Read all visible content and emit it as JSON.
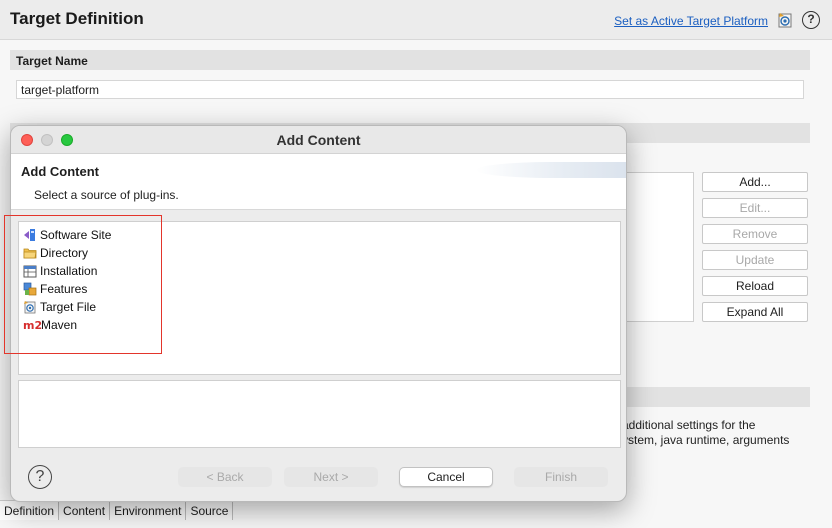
{
  "editor": {
    "title": "Target Definition",
    "active_link": "Set as Active Target Platform",
    "target_name_label": "Target Name",
    "target_name_value": "target-platform",
    "buttons": {
      "add": "Add...",
      "edit": "Edit...",
      "remove": "Remove",
      "update": "Update",
      "reload": "Reload",
      "expand_all": "Expand All"
    },
    "environment_text_line1": "additional settings for the",
    "environment_text_line2": "ystem, java runtime, arguments",
    "tabs": [
      "Definition",
      "Content",
      "Environment",
      "Source"
    ]
  },
  "dialog": {
    "title": "Add Content",
    "banner_title": "Add Content",
    "banner_description": "Select a source of plug-ins.",
    "sources": [
      {
        "label": "Software Site",
        "icon": "software-site-icon"
      },
      {
        "label": "Directory",
        "icon": "folder-icon"
      },
      {
        "label": "Installation",
        "icon": "installation-icon"
      },
      {
        "label": "Features",
        "icon": "features-icon"
      },
      {
        "label": "Target File",
        "icon": "target-file-icon"
      },
      {
        "label": "Maven",
        "icon": "maven-m2-icon"
      }
    ],
    "buttons": {
      "back": "< Back",
      "next": "Next >",
      "cancel": "Cancel",
      "finish": "Finish"
    },
    "maven_badge": "m2",
    "help_glyph": "?"
  },
  "colors": {
    "highlight": "#e3352b",
    "link": "#1b5fc1",
    "traffic_close": "#fe5f57",
    "traffic_max": "#28c840"
  }
}
